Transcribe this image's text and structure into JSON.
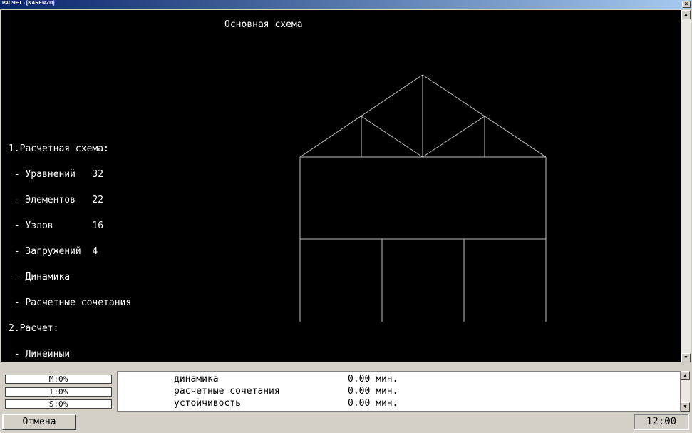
{
  "window": {
    "title": "РАСЧЕТ - [KAREMZD]",
    "close_glyph": "×"
  },
  "main": {
    "heading": "Основная схема",
    "info_lines": [
      "1.Расчетная схема:",
      " - Уравнений   32",
      " - Элементов   22",
      " - Узлов       16",
      " - Загружений  4",
      " - Динамика",
      " - Расчетные сочетания",
      "2.Расчет:",
      " - Линейный"
    ]
  },
  "gauges": [
    "M:0%",
    "I:0%",
    "S:0%"
  ],
  "log": [
    {
      "name": "динамика",
      "value": "0.00 мин."
    },
    {
      "name": "расчетные сочетания",
      "value": "0.00 мин."
    },
    {
      "name": "устойчивость",
      "value": "0.00 мин."
    }
  ],
  "footer": {
    "cancel_label": "Отмена",
    "clock": "12:00"
  },
  "colors": {
    "background": "#000000",
    "line": "#c0c0c0",
    "text": "#ffffff"
  }
}
